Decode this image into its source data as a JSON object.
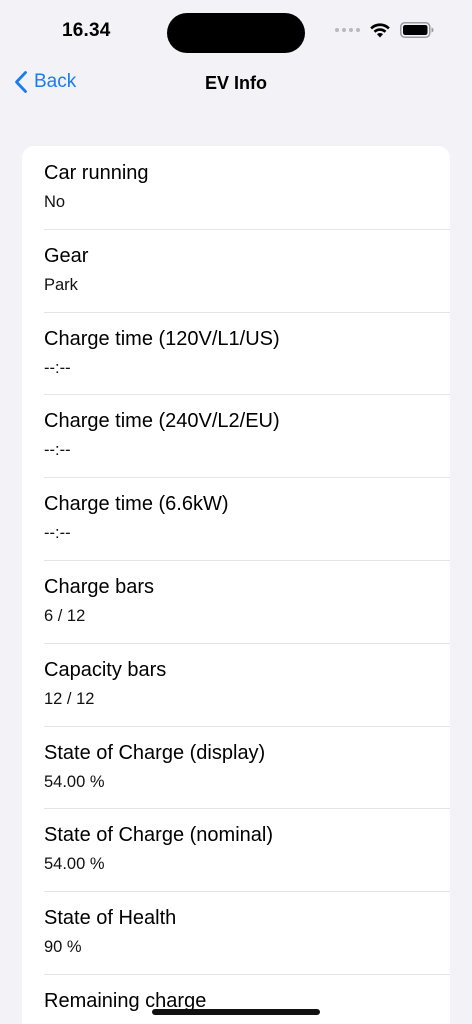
{
  "status_bar": {
    "time": "16.34",
    "icons": [
      "signal-dots-icon",
      "wifi-icon",
      "battery-icon"
    ]
  },
  "nav": {
    "back_label": "Back",
    "title": "EV Info",
    "accent_color": "#1a7cf2"
  },
  "rows": [
    {
      "title": "Car running",
      "value": "No"
    },
    {
      "title": "Gear",
      "value": "Park"
    },
    {
      "title": "Charge time (120V/L1/US)",
      "value": "--:--"
    },
    {
      "title": "Charge time (240V/L2/EU)",
      "value": "--:--"
    },
    {
      "title": "Charge time (6.6kW)",
      "value": "--:--"
    },
    {
      "title": "Charge bars",
      "value": "6 / 12"
    },
    {
      "title": "Capacity bars",
      "value": "12 / 12"
    },
    {
      "title": "State of Charge (display)",
      "value": "54.00 %"
    },
    {
      "title": "State of Charge (nominal)",
      "value": "54.00 %"
    },
    {
      "title": "State of Health",
      "value": "90 %"
    },
    {
      "title": "Remaining charge",
      "value": ""
    }
  ]
}
